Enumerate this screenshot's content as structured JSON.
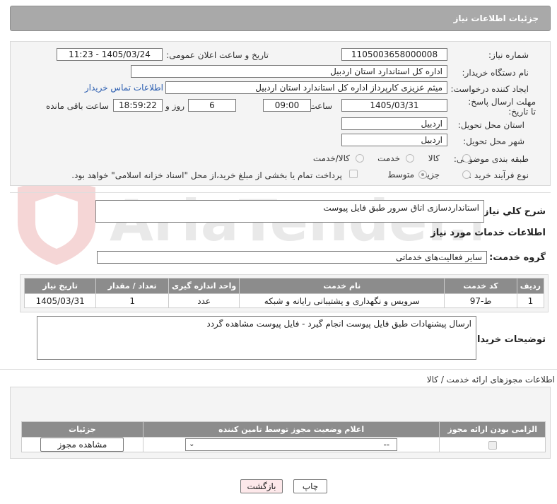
{
  "header": {
    "title": "جزئیات اطلاعات نیاز"
  },
  "form": {
    "need_number_label": "شماره نیاز:",
    "need_number": "1105003658000008",
    "announce_label": "تاریخ و ساعت اعلان عمومی:",
    "announce_value": "1405/03/24 - 11:23",
    "buyer_org_label": "نام دستگاه خریدار:",
    "buyer_org": "اداره کل استاندارد استان اردبیل",
    "requester_label": "ایجاد کننده درخواست:",
    "requester": "میثم عزیزی کارپرداز اداره کل استاندارد استان اردبیل",
    "contact_link": "اطلاعات تماس خریدار",
    "deadline_label": "مهلت ارسال پاسخ: تا تاریخ:",
    "deadline_date": "1405/03/31",
    "time_label": "ساعت",
    "deadline_time": "09:00",
    "days_value": "6",
    "days_label": "روز و",
    "remaining_time": "18:59:22",
    "remaining_label": "ساعت باقی مانده",
    "province_label": "استان محل تحویل:",
    "province": "اردبیل",
    "city_label": "شهر محل تحویل:",
    "city": "اردبیل",
    "category_label": "طبقه بندی موضوعی:",
    "category_options": [
      "کالا",
      "خدمت",
      "کالا/خدمت"
    ],
    "process_label": "نوع فرآیند خرید :",
    "process_options": [
      "جزیی",
      "متوسط"
    ],
    "payment_note": "پرداخت تمام یا بخشی از مبلغ خرید،از محل \"اسناد خزانه اسلامی\" خواهد بود."
  },
  "summary": {
    "label": "شرح کلي نياز:",
    "value": "استانداردسازی اتاق سرور طبق فایل پیوست"
  },
  "services": {
    "section_title": "اطلاعات خدمات مورد نیاز",
    "group_label": "گروه خدمت:",
    "group_value": "سایر فعالیت‌های خدماتی",
    "columns": [
      "ردیف",
      "کد خدمت",
      "نام خدمت",
      "واحد اندازه گیری",
      "تعداد / مقدار",
      "تاریخ نیاز"
    ],
    "rows": [
      [
        "1",
        "ط-97",
        "سرویس و نگهداری و پشتیبانی رایانه و شبکه",
        "عدد",
        "1",
        "1405/03/31"
      ]
    ]
  },
  "buyer_notes": {
    "label": "توضیحات خریدار:",
    "value": "ارسال پیشنهادات طبق فایل پیوست انجام گیرد - فایل پیوست مشاهده گردد"
  },
  "permits": {
    "section_title": "اطلاعات مجوزهای ارائه خدمت / کالا",
    "columns": [
      "الزامی بودن ارائه مجوز",
      "اعلام وضعیت مجوز توسط تامین کننده",
      "جزئیات"
    ],
    "select_value": "--",
    "view_button": "مشاهده مجوز"
  },
  "buttons": {
    "print": "چاپ",
    "back": "بازگشت"
  },
  "watermark": {
    "text": "AriaTender.neT"
  },
  "colors": {
    "header_bg": "#a9a9a9",
    "table_header_bg": "#8c8c8c",
    "link": "#2a5db0",
    "back_button_bg": "#fde8ea"
  }
}
